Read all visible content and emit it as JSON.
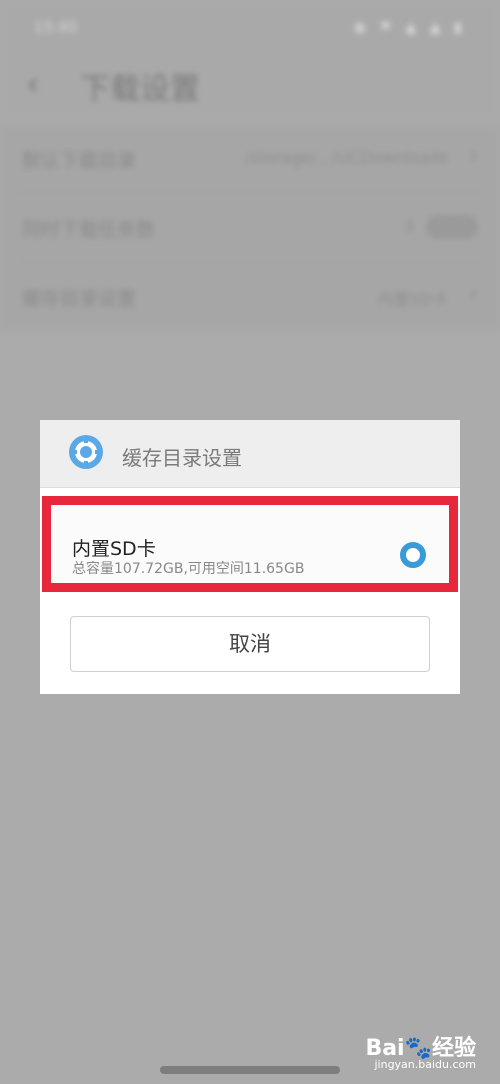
{
  "status_bar": {
    "time": "15:40",
    "icons": "◉ ⚑ ▲ ▲ ▮"
  },
  "app_bar": {
    "back_icon": "‹",
    "title": "下载设置"
  },
  "settings": [
    {
      "label": "默认下载目录",
      "value": "/storage/.../UCDownloads",
      "chevron": "›"
    },
    {
      "label": "同时下载任务数",
      "value": "3",
      "chevron": ""
    },
    {
      "label": "缓存目录设置",
      "value": "内置SD卡",
      "chevron": "›"
    }
  ],
  "dialog": {
    "title": "缓存目录设置",
    "icon": "gear-icon",
    "option": {
      "title": "内置SD卡",
      "description": "总容量107.72GB,可用空间11.65GB",
      "selected": true
    },
    "cancel_label": "取消"
  },
  "watermark": {
    "brand": "Bai🐾经验",
    "url": "jingyan.baidu.com"
  },
  "colors": {
    "accent": "#3a9ad9",
    "highlight": "#e6273c",
    "overlay": "#ababab"
  }
}
